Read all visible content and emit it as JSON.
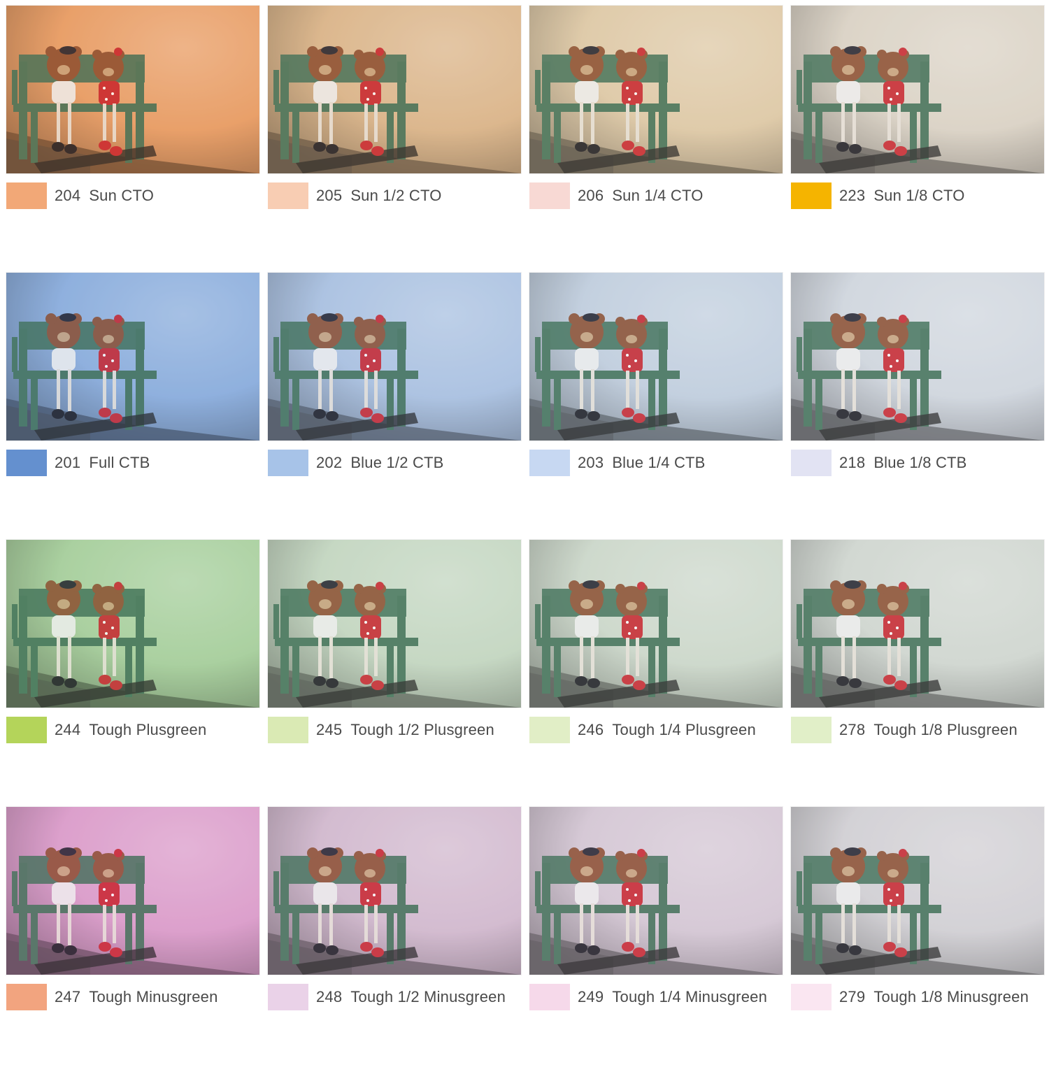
{
  "filters": [
    {
      "code": "204",
      "name": "Sun CTO",
      "swatch": "#f2a877",
      "tint": "#e9a06a"
    },
    {
      "code": "205",
      "name": "Sun 1/2 CTO",
      "swatch": "#f8cdb3",
      "tint": "#dcb88e"
    },
    {
      "code": "206",
      "name": "Sun 1/4 CTO",
      "swatch": "#f8d9d4",
      "tint": "#e0cbaa"
    },
    {
      "code": "223",
      "name": "Sun 1/8 CTO",
      "swatch": "#f5b400",
      "tint": "#dcd5c8"
    },
    {
      "code": "201",
      "name": "Full CTB",
      "swatch": "#6490cf",
      "tint": "#8fb0de"
    },
    {
      "code": "202",
      "name": "Blue 1/2 CTB",
      "swatch": "#a7c3e8",
      "tint": "#aec4e2"
    },
    {
      "code": "203",
      "name": "Blue 1/4 CTB",
      "swatch": "#c7d8f2",
      "tint": "#c4d0e0"
    },
    {
      "code": "218",
      "name": "Blue 1/8 CTB",
      "swatch": "#e2e3f3",
      "tint": "#d2d8e0"
    },
    {
      "code": "244",
      "name": "Tough Plusgreen",
      "swatch": "#b4d45a",
      "tint": "#aad0a0"
    },
    {
      "code": "245",
      "name": "Tough 1/2 Plusgreen",
      "swatch": "#daeab4",
      "tint": "#c6d8c4"
    },
    {
      "code": "246",
      "name": "Tough 1/4 Plusgreen",
      "swatch": "#e1eec6",
      "tint": "#cfdacd"
    },
    {
      "code": "278",
      "name": "Tough 1/8 Plusgreen",
      "swatch": "#e1efc8",
      "tint": "#d2d8d2"
    },
    {
      "code": "247",
      "name": "Tough Minusgreen",
      "swatch": "#f2a47f",
      "tint": "#dca0cc"
    },
    {
      "code": "248",
      "name": "Tough 1/2 Minusgreen",
      "swatch": "#ead2e8",
      "tint": "#d4bcd0"
    },
    {
      "code": "249",
      "name": "Tough 1/4 Minusgreen",
      "swatch": "#f6d9ea",
      "tint": "#d6cad6"
    },
    {
      "code": "279",
      "name": "Tough 1/8 Minusgreen",
      "swatch": "#fae6f1",
      "tint": "#d4d2d6"
    }
  ]
}
